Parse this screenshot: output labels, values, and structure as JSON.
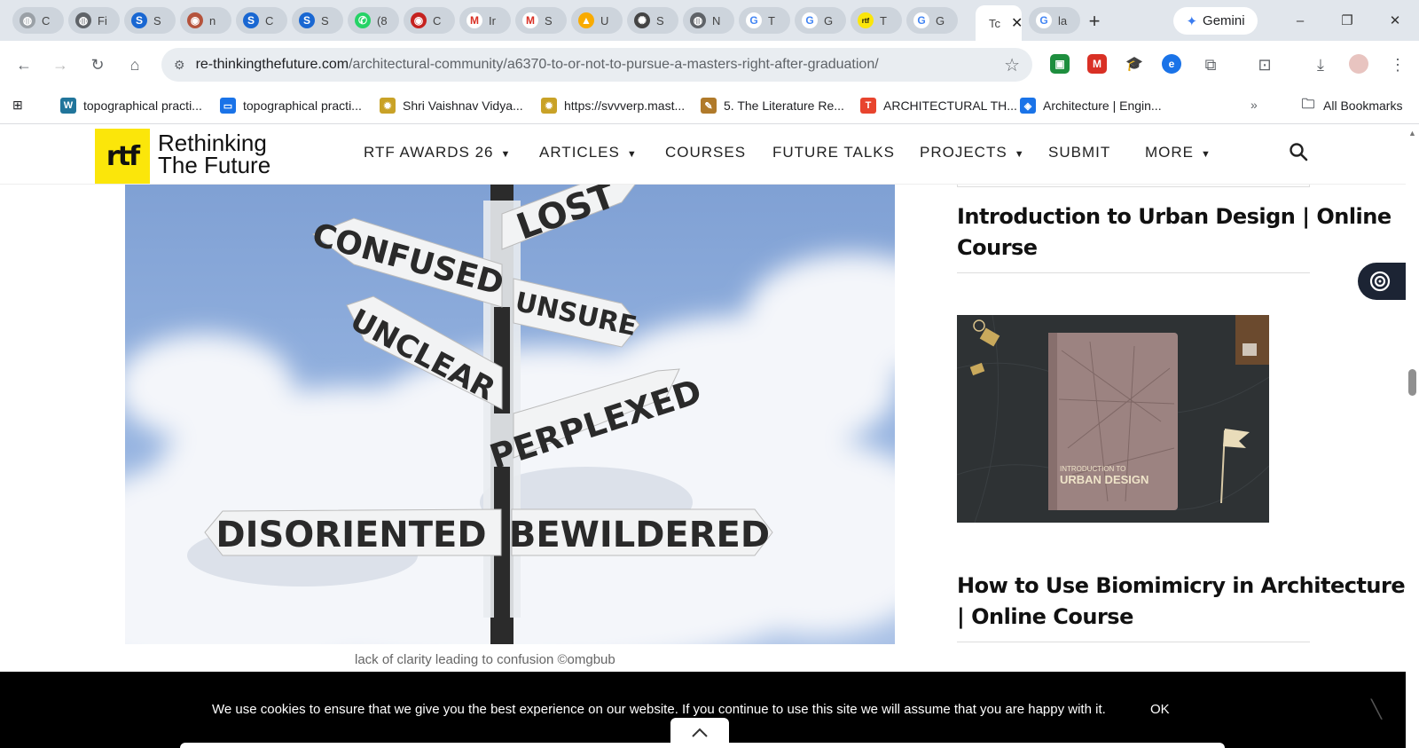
{
  "browser": {
    "tabs": [
      {
        "abbr": "C",
        "icon": "globe-icon",
        "color": "#9aa0a6"
      },
      {
        "abbr": "Fi",
        "icon": "globe-icon",
        "color": "#5f6368"
      },
      {
        "abbr": "S",
        "icon": "s-logo-icon",
        "color": "#1967d2"
      },
      {
        "abbr": "n",
        "icon": "university-icon",
        "color": "#b5533c"
      },
      {
        "abbr": "C",
        "icon": "s-logo-icon",
        "color": "#1967d2"
      },
      {
        "abbr": "S",
        "icon": "s-logo-icon",
        "color": "#1967d2"
      },
      {
        "abbr": "(8",
        "icon": "whatsapp-icon",
        "color": "#25d366"
      },
      {
        "abbr": "C",
        "icon": "university-icon",
        "color": "#c5221f"
      },
      {
        "abbr": "Ir",
        "icon": "gmail-icon",
        "color": "#d93025"
      },
      {
        "abbr": "S",
        "icon": "gmail-icon",
        "color": "#d93025"
      },
      {
        "abbr": "U",
        "icon": "drive-icon",
        "color": "#f9ab00"
      },
      {
        "abbr": "S",
        "icon": "openai-icon",
        "color": "#444444"
      },
      {
        "abbr": "N",
        "icon": "globe-icon",
        "color": "#5f6368"
      },
      {
        "abbr": "T",
        "icon": "google-icon",
        "color": "#4285f4"
      },
      {
        "abbr": "G",
        "icon": "google-icon",
        "color": "#4285f4"
      },
      {
        "abbr": "T",
        "icon": "rtf-icon",
        "color": "#fbe60a"
      },
      {
        "abbr": "G",
        "icon": "google-icon",
        "color": "#4285f4"
      }
    ],
    "active_tab": {
      "abbr": "Tc"
    },
    "after_tab": {
      "abbr": "la",
      "icon": "google-icon"
    },
    "new_tab": "+",
    "gemini_label": "Gemini",
    "window_controls": {
      "minimize": "–",
      "restore": "❐",
      "close": "✕"
    },
    "url_domain": "re-thinkingthefuture.com",
    "url_path": "/architectural-community/a6370-to-or-not-to-pursue-a-masters-right-after-graduation/",
    "bookmarks": [
      {
        "label": "topographical practi...",
        "icon": "wordpress-icon",
        "color": "#21759b"
      },
      {
        "label": "topographical practi...",
        "icon": "folder-blue-icon",
        "color": "#1a73e8"
      },
      {
        "label": "Shri Vaishnav Vidya...",
        "icon": "seal-icon",
        "color": "#c9a227"
      },
      {
        "label": "https://svvverp.mast...",
        "icon": "seal-icon",
        "color": "#c9a227"
      },
      {
        "label": "5. The Literature Re...",
        "icon": "pen-icon",
        "color": "#b07a2a"
      },
      {
        "label": "ARCHITECTURAL TH...",
        "icon": "doc-red-icon",
        "color": "#e8442e"
      },
      {
        "label": "Architecture | Engin...",
        "icon": "sphere-icon",
        "color": "#1a73e8"
      }
    ],
    "bookmarks_more": "»",
    "all_bookmarks": "All Bookmarks"
  },
  "site": {
    "logo_mark": "rtf",
    "logo_line1": "Rethinking",
    "logo_line2": "The Future",
    "nav": [
      {
        "label": "RTF AWARDS 26",
        "dropdown": true
      },
      {
        "label": "ARTICLES",
        "dropdown": true
      },
      {
        "label": "COURSES",
        "dropdown": false
      },
      {
        "label": "FUTURE TALKS",
        "dropdown": false
      },
      {
        "label": "PROJECTS",
        "dropdown": true
      },
      {
        "label": "SUBMIT",
        "dropdown": false
      },
      {
        "label": "MORE",
        "dropdown": true
      }
    ],
    "accent_color": "#fbe60a"
  },
  "article": {
    "sign_words": [
      "LOST",
      "CONFUSED",
      "UNSURE",
      "UNCLEAR",
      "PERPLEXED",
      "DISORIENTED",
      "BEWILDERED"
    ],
    "caption": "lack of clarity leading to confusion ©omgbub"
  },
  "sidebar": {
    "course1_title": "Introduction to Urban Design | Online Course",
    "course1_book_line1": "INTRODUCTION TO",
    "course1_book_line2": "URBAN DESIGN",
    "course2_title": "How to Use Biomimicry in Architecture | Online Course"
  },
  "cookie": {
    "message": "We use cookies to ensure that we give you the best experience on our website. If you continue to use this site we will assume that you are happy with it.",
    "ok_label": "OK"
  }
}
